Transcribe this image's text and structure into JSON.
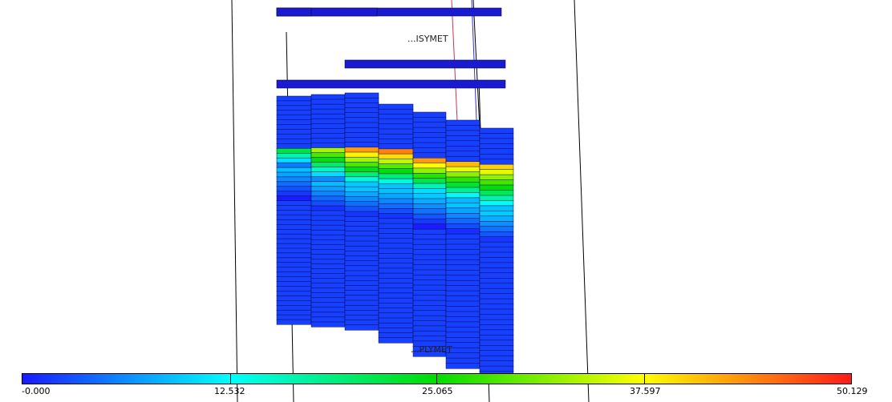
{
  "viewer": {
    "property": "reservoir grid property",
    "colormap": [
      "#1a1aff",
      "#00ffff",
      "#00dd00",
      "#ffff00",
      "#ff1a1a"
    ],
    "well_labels": [
      "...ISYMET",
      "...PLYMET"
    ]
  },
  "legend": {
    "min_label": "-0.000",
    "tick_labels": [
      "-0.000",
      "12.532",
      "25.065",
      "37.597",
      "50.129"
    ],
    "min": 0.0,
    "max": 50.129
  }
}
